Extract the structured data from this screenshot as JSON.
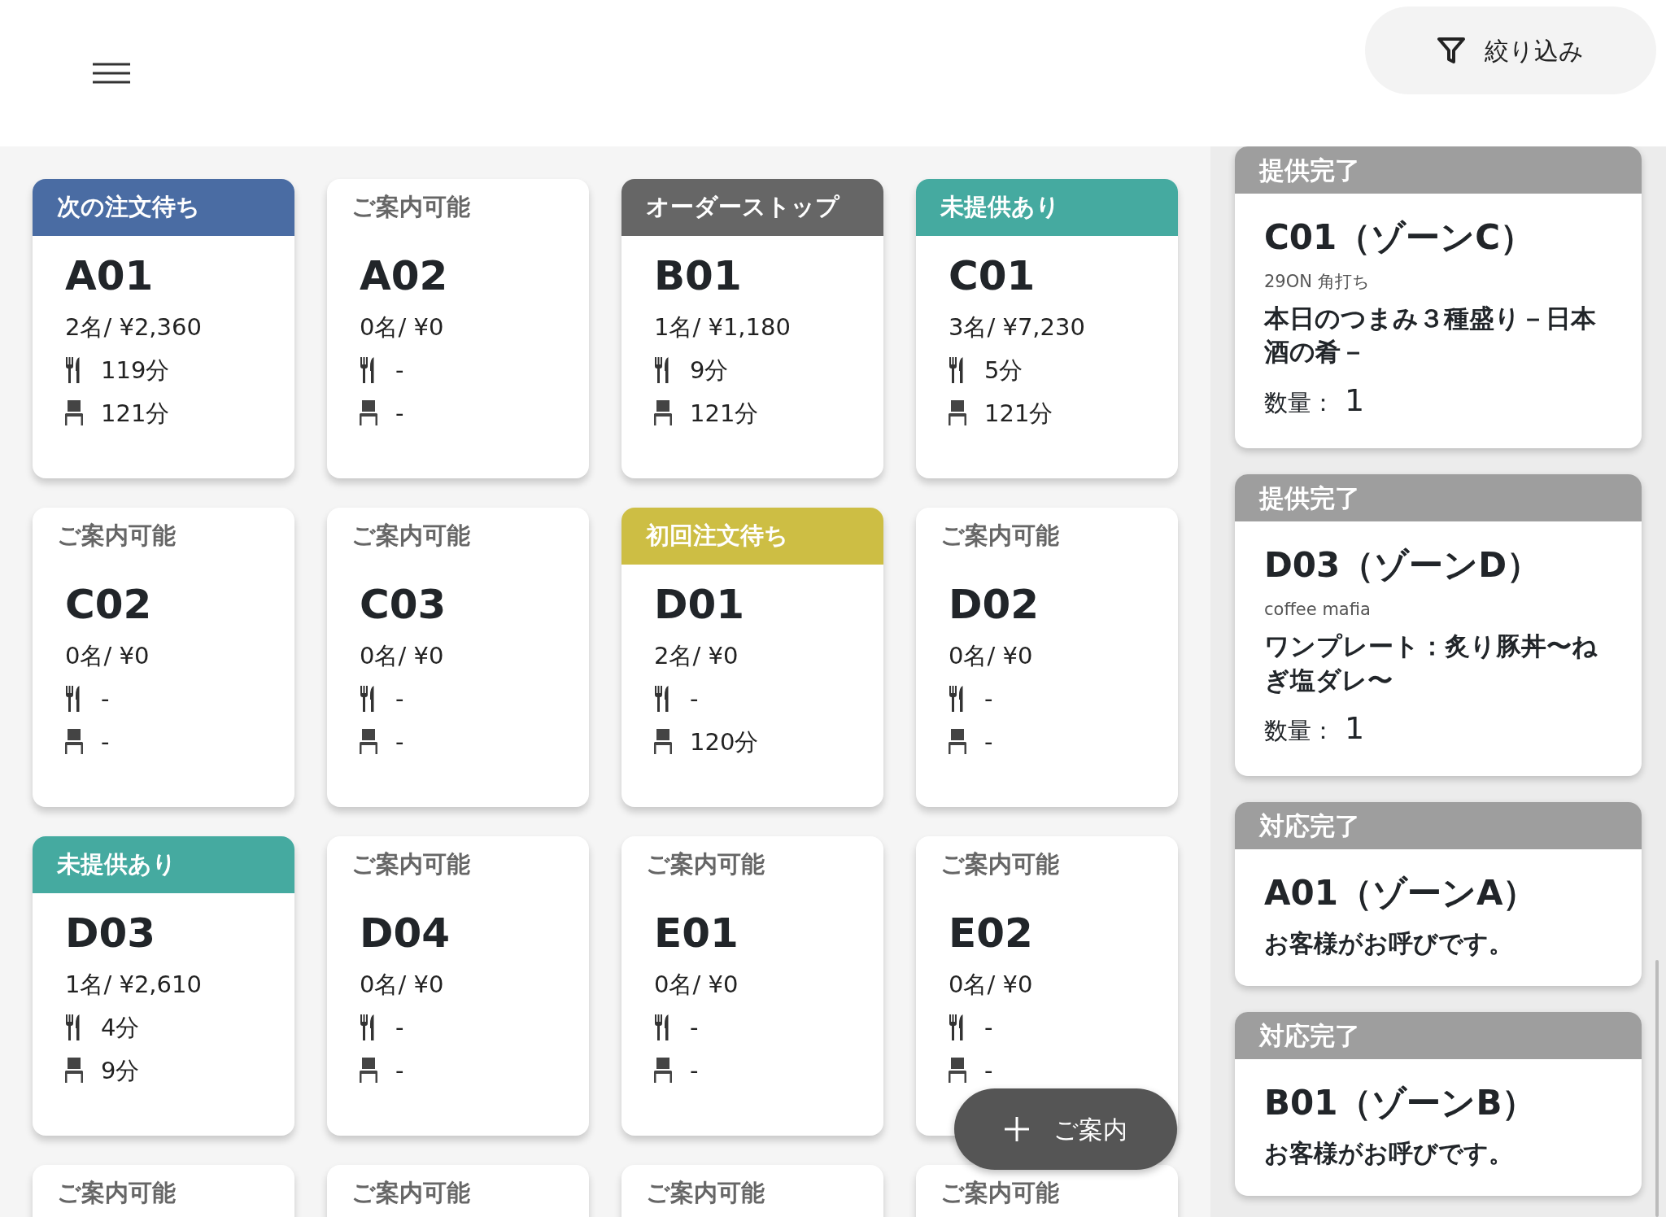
{
  "header": {
    "filter_button": "絞り込み"
  },
  "tables": [
    {
      "kind": "band",
      "status": "次の注文待ち",
      "color": "#4a6ca3",
      "name": "A01",
      "guests": "2名/ ¥2,360",
      "order_time": "119分",
      "seat_time": "121分"
    },
    {
      "kind": "plain",
      "status": "ご案内可能",
      "name": "A02",
      "guests": "0名/ ¥0",
      "order_time": "-",
      "seat_time": "-"
    },
    {
      "kind": "band",
      "status": "オーダーストップ",
      "color": "#666666",
      "name": "B01",
      "guests": "1名/ ¥1,180",
      "order_time": "9分",
      "seat_time": "121分"
    },
    {
      "kind": "band",
      "status": "未提供あり",
      "color": "#45aaa0",
      "name": "C01",
      "guests": "3名/ ¥7,230",
      "order_time": "5分",
      "seat_time": "121分"
    },
    {
      "kind": "plain",
      "status": "ご案内可能",
      "name": "C02",
      "guests": "0名/ ¥0",
      "order_time": "-",
      "seat_time": "-"
    },
    {
      "kind": "plain",
      "status": "ご案内可能",
      "name": "C03",
      "guests": "0名/ ¥0",
      "order_time": "-",
      "seat_time": "-"
    },
    {
      "kind": "band",
      "status": "初回注文待ち",
      "color": "#cdbe44",
      "name": "D01",
      "guests": "2名/ ¥0",
      "order_time": "-",
      "seat_time": "120分"
    },
    {
      "kind": "plain",
      "status": "ご案内可能",
      "name": "D02",
      "guests": "0名/ ¥0",
      "order_time": "-",
      "seat_time": "-"
    },
    {
      "kind": "band",
      "status": "未提供あり",
      "color": "#45aaa0",
      "name": "D03",
      "guests": "1名/ ¥2,610",
      "order_time": "4分",
      "seat_time": "9分"
    },
    {
      "kind": "plain",
      "status": "ご案内可能",
      "name": "D04",
      "guests": "0名/ ¥0",
      "order_time": "-",
      "seat_time": "-"
    },
    {
      "kind": "plain",
      "status": "ご案内可能",
      "name": "E01",
      "guests": "0名/ ¥0",
      "order_time": "-",
      "seat_time": "-"
    },
    {
      "kind": "plain",
      "status": "ご案内可能",
      "name": "E02",
      "guests": "0名/ ¥0",
      "order_time": "-",
      "seat_time": "-"
    },
    {
      "kind": "plain",
      "status": "ご案内可能"
    },
    {
      "kind": "plain",
      "status": "ご案内可能"
    },
    {
      "kind": "plain",
      "status": "ご案内可能"
    },
    {
      "kind": "plain",
      "status": "ご案内可能"
    }
  ],
  "fab": "ご案内",
  "notifications": [
    {
      "kind": "served",
      "status": "提供完了",
      "title": "C01（ゾーンC）",
      "shop": "29ON 角打ち",
      "item": "本日のつまみ３種盛り－日本酒の肴－",
      "qty_label": "数量：",
      "qty": "1"
    },
    {
      "kind": "served",
      "status": "提供完了",
      "title": "D03（ゾーンD）",
      "shop": "coffee mafia",
      "item": "ワンプレート：炙り豚丼〜ねぎ塩ダレ〜",
      "qty_label": "数量：",
      "qty": "1"
    },
    {
      "kind": "call",
      "status": "対応完了",
      "title": "A01（ゾーンA）",
      "message": "お客様がお呼びです。"
    },
    {
      "kind": "call",
      "status": "対応完了",
      "title": "B01（ゾーンB）",
      "message": "お客様がお呼びです。"
    }
  ]
}
